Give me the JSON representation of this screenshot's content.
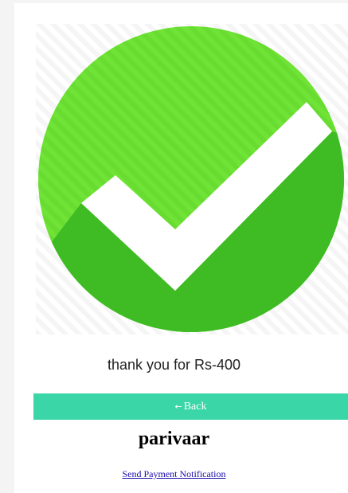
{
  "icon": "checkmark-success-icon",
  "colors": {
    "accent": "#3bd6a7",
    "check_green": "#6fe436",
    "check_shadow": "#3fbb24"
  },
  "message": "thank you for Rs-400",
  "back_button": {
    "arrow": "←",
    "label": "Back"
  },
  "brand_name": "parivaar",
  "notification_link": "Send Payment Notification"
}
